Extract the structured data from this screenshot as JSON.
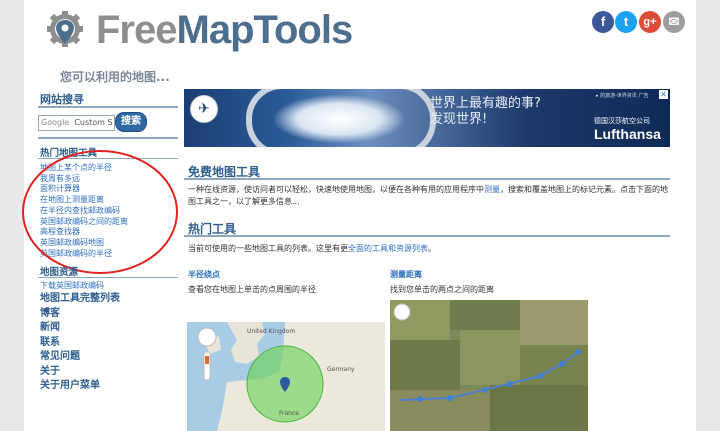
{
  "header": {
    "logo_part1": "Free",
    "logo_part2": "MapTools",
    "tagline": "您可以利用的地图..."
  },
  "social": [
    {
      "name": "facebook-icon",
      "glyph": "f",
      "color": "#3b5998"
    },
    {
      "name": "twitter-icon",
      "glyph": "t",
      "color": "#1da1f2"
    },
    {
      "name": "google-plus-icon",
      "glyph": "g+",
      "color": "#dd4b39"
    },
    {
      "name": "email-icon",
      "glyph": "✉",
      "color": "#9e9e9e"
    }
  ],
  "sidebar": {
    "search_heading": "网站搜寻",
    "search_google": "Google",
    "search_placeholder": "Custom S",
    "search_button": "搜索",
    "hot_tools_heading": "热门地图工具",
    "hot_tools": [
      "地图上某个点的半径",
      "我周有多远",
      "面积计算器",
      "在地图上测量距离",
      "在半径内查找邮政编码",
      "英国邮政编码之间的距离",
      "高程查找器",
      "英国邮政编码地图",
      "英国邮政编码的半径"
    ],
    "resources_heading": "地图资源",
    "resources_link": "下载英国邮政编码",
    "bold_links": [
      "地图工具完整列表",
      "博客",
      "新闻",
      "联系",
      "常见问题",
      "关于",
      "关于用户菜单"
    ]
  },
  "banner": {
    "line1": "世界上最有趣的事?",
    "line2": "发现世界!",
    "small_top": "▸ 的旅游-世界资讯 广告",
    "brand_small": "德国汉莎航空公司",
    "brand": "Lufthansa"
  },
  "main": {
    "free_heading": "免费地图工具",
    "free_p1": "一种在线资源，使访问者可以轻松，快速地使用地图，以便在各种有用的应用程序中",
    "free_link": "测量",
    "free_p2": "，搜索和覆盖地图上的标记元素。点击下面的地图工具之一，以了解更多信息...",
    "hot_heading": "热门工具",
    "hot_p1": "当前可使用的一些地图工具的列表。这里有更",
    "hot_link": "全面的工具和资源列表",
    "hot_p2": "。",
    "col1_title": "半径绕点",
    "col1_desc": "查看您在地图上单击的点周围的半径",
    "col2_title": "测量距离",
    "col2_desc": "找到您单击的两点之间的距离",
    "map1_labels": [
      "United Kingdom",
      "Germany",
      "France"
    ]
  }
}
